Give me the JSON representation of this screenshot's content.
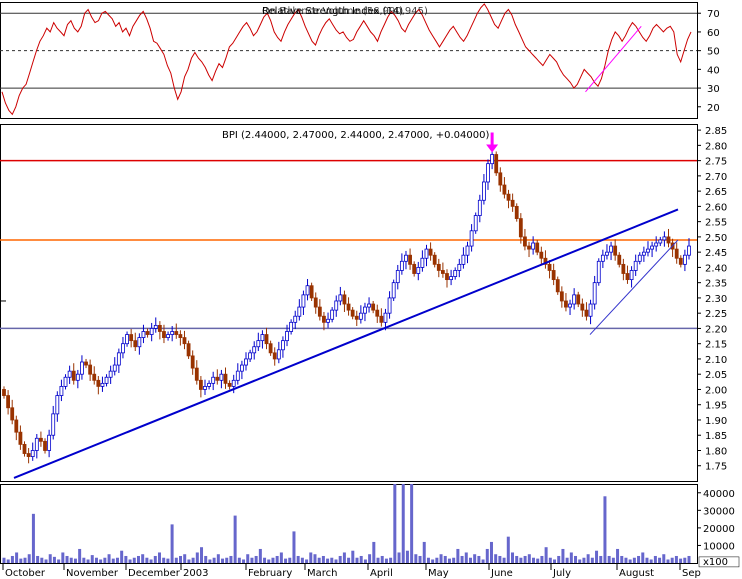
{
  "chart_data": [
    {
      "panel": "rsi",
      "type": "line",
      "title": "Relative Strength Index (14)",
      "title_overlay": "On Balance Volume (56,990,945)",
      "ylim": [
        14,
        76
      ],
      "yticks": [
        20,
        30,
        40,
        50,
        60,
        70
      ],
      "reference_lines": [
        {
          "value": 70,
          "style": "solid"
        },
        {
          "value": 50,
          "style": "dashed"
        },
        {
          "value": 30,
          "style": "solid"
        }
      ],
      "series": [
        {
          "color": "#cc0000",
          "values": [
            28,
            22,
            18,
            16,
            20,
            26,
            30,
            32,
            38,
            44,
            50,
            55,
            58,
            62,
            60,
            65,
            62,
            60,
            58,
            64,
            66,
            62,
            60,
            63,
            70,
            72,
            68,
            65,
            66,
            70,
            71,
            69,
            67,
            63,
            65,
            60,
            62,
            58,
            63,
            66,
            69,
            71,
            67,
            62,
            55,
            54,
            51,
            48,
            42,
            38,
            30,
            24,
            28,
            36,
            40,
            46,
            49,
            46,
            44,
            41,
            37,
            34,
            39,
            43,
            41,
            46,
            52,
            54,
            57,
            60,
            63,
            65,
            62,
            58,
            60,
            64,
            68,
            70,
            66,
            60,
            57,
            55,
            60,
            64,
            67,
            70,
            72,
            68,
            63,
            59,
            55,
            53,
            58,
            62,
            65,
            67,
            64,
            61,
            59,
            60,
            57,
            55,
            56,
            60,
            63,
            66,
            63,
            60,
            58,
            55,
            60,
            64,
            68,
            71,
            69,
            66,
            62,
            60,
            64,
            67,
            70,
            72,
            69,
            65,
            61,
            58,
            55,
            52,
            55,
            58,
            61,
            63,
            60,
            57,
            55,
            58,
            62,
            66,
            70,
            73,
            75,
            72,
            68,
            64,
            62,
            66,
            70,
            72,
            69,
            64,
            60,
            56,
            52,
            50,
            48,
            46,
            44,
            42,
            45,
            48,
            46,
            44,
            40,
            37,
            35,
            33,
            30,
            32,
            36,
            40,
            38,
            36,
            33,
            31,
            35,
            42,
            50,
            56,
            60,
            58,
            55,
            58,
            62,
            65,
            63,
            60,
            57,
            55,
            58,
            62,
            64,
            62,
            60,
            62,
            63,
            60,
            48,
            44,
            50,
            56,
            60
          ]
        }
      ],
      "trendline": {
        "color": "#ff00ff",
        "from": [
          0.84,
          28
        ],
        "to": [
          0.92,
          63
        ]
      }
    },
    {
      "panel": "price",
      "type": "candlestick",
      "title": "BPI (2.44000, 2.47000, 2.44000, 2.47000, +0.04000)",
      "ylim": [
        1.7,
        2.87
      ],
      "yticks": [
        1.75,
        1.8,
        1.85,
        1.9,
        1.95,
        2.0,
        2.05,
        2.1,
        2.15,
        2.2,
        2.25,
        2.3,
        2.35,
        2.4,
        2.45,
        2.5,
        2.55,
        2.6,
        2.65,
        2.7,
        2.75,
        2.8,
        2.85
      ],
      "horizontal_lines": [
        {
          "value": 2.75,
          "color": "#dd0000"
        },
        {
          "value": 2.49,
          "color": "#ff6600"
        },
        {
          "value": 2.2,
          "color": "#6666aa"
        }
      ],
      "arrow": {
        "color": "#ff00ff",
        "target_value": 2.77
      },
      "trendlines": [
        {
          "color": "#0000cc",
          "from_value": 1.71,
          "to_value": 2.59
        },
        {
          "color": "#3333cc",
          "from_value": 2.18,
          "to_value": 2.49
        }
      ],
      "up_color": "#0000cc",
      "down_color": "#993300",
      "closes": [
        1.98,
        1.94,
        1.9,
        1.86,
        1.82,
        1.79,
        1.78,
        1.8,
        1.84,
        1.83,
        1.8,
        1.85,
        1.92,
        1.98,
        2.01,
        2.04,
        2.06,
        2.03,
        2.05,
        2.09,
        2.08,
        2.05,
        2.03,
        2.01,
        2.02,
        2.04,
        2.06,
        2.08,
        2.12,
        2.15,
        2.18,
        2.16,
        2.14,
        2.17,
        2.19,
        2.18,
        2.2,
        2.21,
        2.19,
        2.17,
        2.18,
        2.19,
        2.18,
        2.17,
        2.15,
        2.11,
        2.07,
        2.03,
        2.0,
        2.01,
        2.02,
        2.04,
        2.03,
        2.05,
        2.02,
        2.01,
        2.03,
        2.06,
        2.08,
        2.1,
        2.12,
        2.14,
        2.16,
        2.18,
        2.15,
        2.12,
        2.1,
        2.13,
        2.16,
        2.19,
        2.22,
        2.24,
        2.27,
        2.31,
        2.34,
        2.3,
        2.27,
        2.24,
        2.22,
        2.23,
        2.26,
        2.29,
        2.31,
        2.28,
        2.26,
        2.24,
        2.23,
        2.25,
        2.27,
        2.28,
        2.26,
        2.24,
        2.22,
        2.25,
        2.3,
        2.35,
        2.39,
        2.42,
        2.44,
        2.41,
        2.38,
        2.4,
        2.43,
        2.46,
        2.44,
        2.41,
        2.39,
        2.38,
        2.36,
        2.37,
        2.39,
        2.41,
        2.44,
        2.47,
        2.52,
        2.57,
        2.62,
        2.68,
        2.74,
        2.77,
        2.71,
        2.67,
        2.64,
        2.62,
        2.6,
        2.56,
        2.5,
        2.47,
        2.46,
        2.48,
        2.45,
        2.43,
        2.41,
        2.39,
        2.36,
        2.32,
        2.29,
        2.27,
        2.28,
        2.31,
        2.28,
        2.26,
        2.24,
        2.28,
        2.35,
        2.42,
        2.44,
        2.45,
        2.47,
        2.44,
        2.41,
        2.38,
        2.36,
        2.39,
        2.42,
        2.44,
        2.45,
        2.46,
        2.47,
        2.48,
        2.49,
        2.5,
        2.48,
        2.46,
        2.43,
        2.41,
        2.44,
        2.47
      ]
    },
    {
      "panel": "volume",
      "type": "bar",
      "ylim": [
        0,
        45000
      ],
      "yticks": [
        10000,
        20000,
        30000,
        40000
      ],
      "ytick_labels": [
        "10000",
        "20000",
        "30000",
        "40000"
      ],
      "unit_label": "x100",
      "color": "#6666cc",
      "values": [
        3000,
        2000,
        4000,
        6000,
        2500,
        3000,
        5000,
        28000,
        4000,
        3000,
        2000,
        5000,
        3500,
        2000,
        6000,
        4000,
        3000,
        2500,
        8000,
        3000,
        2000,
        4500,
        3000,
        2000,
        3000,
        5000,
        2500,
        3000,
        7000,
        4000,
        2000,
        3000,
        4000,
        5000,
        3000,
        2000,
        4000,
        6000,
        3000,
        2500,
        22000,
        3000,
        4000,
        5000,
        2000,
        3000,
        6000,
        9000,
        4000,
        2000,
        3000,
        5000,
        2500,
        3000,
        4000,
        27000,
        3000,
        2000,
        5000,
        3000,
        4000,
        8000,
        3000,
        2000,
        3000,
        4000,
        6000,
        2500,
        3000,
        18000,
        4000,
        3000,
        2000,
        6000,
        5000,
        3000,
        4000,
        2500,
        3000,
        2000,
        4000,
        6000,
        3000,
        7000,
        3000,
        4000,
        2000,
        5000,
        12000,
        3000,
        4000,
        2500,
        3000,
        48000,
        6000,
        48000,
        7000,
        48000,
        5000,
        4000,
        12000,
        3000,
        2000,
        3000,
        5000,
        4000,
        2500,
        3000,
        8000,
        4000,
        6000,
        3000,
        5000,
        4000,
        2000,
        8000,
        12000,
        5000,
        4000,
        3000,
        15000,
        6000,
        4000,
        3000,
        4000,
        5000,
        3000,
        2500,
        4000,
        9000,
        3000,
        2000,
        4000,
        8000,
        3000,
        6000,
        4000,
        2000,
        3000,
        5000,
        3000,
        7000,
        4000,
        38000,
        4000,
        3000,
        8000,
        4000,
        3000,
        2000,
        3000,
        4000,
        6000,
        3000,
        2000,
        4000,
        3000,
        5000,
        2000,
        3000,
        4000,
        2500,
        3000,
        4000
      ]
    }
  ],
  "x_axis": {
    "months": [
      "October",
      "November",
      "December",
      "2003",
      "February",
      "March",
      "April",
      "May",
      "June",
      "July",
      "August",
      "Sep"
    ]
  }
}
